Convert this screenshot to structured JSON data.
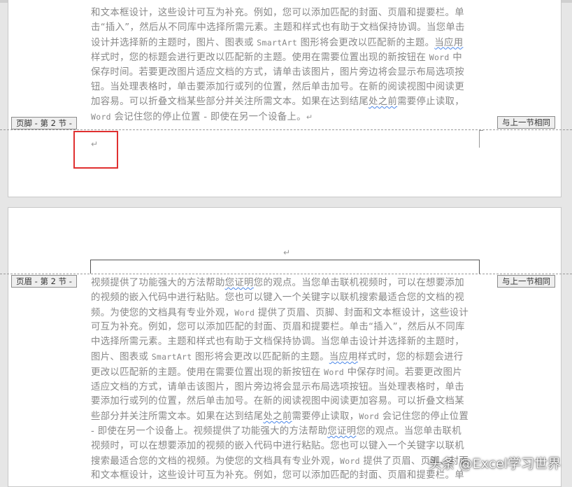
{
  "colors": {
    "background": "#e6e6e6",
    "page": "#ffffff",
    "text": "#888888",
    "highlight_box": "#e03030",
    "spelling_underline": "#4a86e8"
  },
  "section1": {
    "footer_tag": "页脚 - 第 2 节 -",
    "same_as_previous": "与上一节相同",
    "lines": [
      [
        {
          "t": "和文本框设计，这些设计可互为补充。例如，您可以添加匹配的封面、页眉和提要栏。单"
        }
      ],
      [
        {
          "t": "击“插入”，然后从不同库中选择所需元素。主题和样式也有助于文档保持协调。当您单击"
        }
      ],
      [
        {
          "t": "设计并选择新的主题时，图片、图表或 "
        },
        {
          "t": "SmartArt",
          "mono": true
        },
        {
          "t": " 图形将会更改以匹配新的主题。"
        },
        {
          "t": "当应用",
          "wavy": true
        }
      ],
      [
        {
          "t": "样式时，您的标题会进行更改以匹配新的主题。使用在需要位置出现的新按钮在 "
        },
        {
          "t": "Word",
          "mono": true
        },
        {
          "t": " 中"
        }
      ],
      [
        {
          "t": "保存时间。若要更改图片适应文档的方式，请单击该图片，图片旁边将会显示布局选项按"
        }
      ],
      [
        {
          "t": "钮。当处理表格时，单击要添加行或列的位置，然后单击加号。在新的阅读视图中阅读更"
        }
      ],
      [
        {
          "t": "加容易。可以折叠文档某些部分并关注所需文本。如果在达到结尾"
        },
        {
          "t": "处之前",
          "wavy": true
        },
        {
          "t": "需要停止读取，"
        }
      ],
      [
        {
          "t": "Word",
          "mono": true
        },
        {
          "t": " 会记住您的停止位置 - 即使在另一个设备上。"
        },
        {
          "t": "↵",
          "mark": true
        }
      ]
    ],
    "footer_paragraph_mark": "↵"
  },
  "section2": {
    "header_tag": "页眉 - 第 2 节 -",
    "same_as_previous": "与上一节相同",
    "header_paragraph_mark": "↵",
    "lines": [
      [
        {
          "t": "视频提供了功能强大的方法帮助"
        },
        {
          "t": "您证明",
          "wavy": true
        },
        {
          "t": "您的观点。当您单击联机视频时，可以在想要添加"
        }
      ],
      [
        {
          "t": "的视频的嵌入代码中进行粘贴。您也可以键入一个关键字以联机搜索最适合您的文档的视"
        }
      ],
      [
        {
          "t": "频。为使您的文档具有专业外观，"
        },
        {
          "t": "Word",
          "mono": true
        },
        {
          "t": " 提供了页眉、页脚、封面和文本框设计，这些设计"
        }
      ],
      [
        {
          "t": "可互为补充。例如，您可以添加匹配的封面、页眉和提要栏。单击“插入”，然后从不同库"
        }
      ],
      [
        {
          "t": "中选择所需元素。主题和样式也有助于文档保持协调。当您单击设计并选择新的主题时，"
        }
      ],
      [
        {
          "t": "图片、图表或 "
        },
        {
          "t": "SmartArt",
          "mono": true
        },
        {
          "t": " 图形将会更改以匹配新的主题。"
        },
        {
          "t": "当应用",
          "wavy": true
        },
        {
          "t": "样式时，您的标题会进行"
        }
      ],
      [
        {
          "t": "更改以匹配新的主题。使用在需要位置出现的新按钮在 "
        },
        {
          "t": "Word",
          "mono": true
        },
        {
          "t": " 中保存时间。若要更改图片"
        }
      ],
      [
        {
          "t": "适应文档的方式，请单击该图片，图片旁边将会显示布局选项按钮。当处理表格时，单击"
        }
      ],
      [
        {
          "t": "要添加行或列的位置，然后单击加号。在新的阅读视图中阅读更加容易。可以折叠文档某"
        }
      ],
      [
        {
          "t": "些部分并关注所需文本。如果在达到结尾"
        },
        {
          "t": "处之前",
          "wavy": true
        },
        {
          "t": "需要停止读取，"
        },
        {
          "t": "Word",
          "mono": true
        },
        {
          "t": " 会记住您的停止位置"
        }
      ],
      [
        {
          "t": "- 即使在另一个设备上。视频提供了功能强大的方法帮助"
        },
        {
          "t": "您证明",
          "wavy": true
        },
        {
          "t": "您的观点。当您单击联机"
        }
      ],
      [
        {
          "t": "视频时，可以在想要添加的视频的嵌入代码中进行粘贴。您也可以键入一个关键字以联机"
        }
      ],
      [
        {
          "t": "搜索最适合您的文档的视频。为使您的文档具有专业外观，"
        },
        {
          "t": "Word",
          "mono": true
        },
        {
          "t": " 提供了页眉、页脚、封面"
        }
      ],
      [
        {
          "t": "和文本框设计，这些设计可互为补充。例如，您可以添加匹配的封面、页眉和提要栏。单"
        }
      ]
    ]
  },
  "watermark": "头条 @Excel学习世界"
}
